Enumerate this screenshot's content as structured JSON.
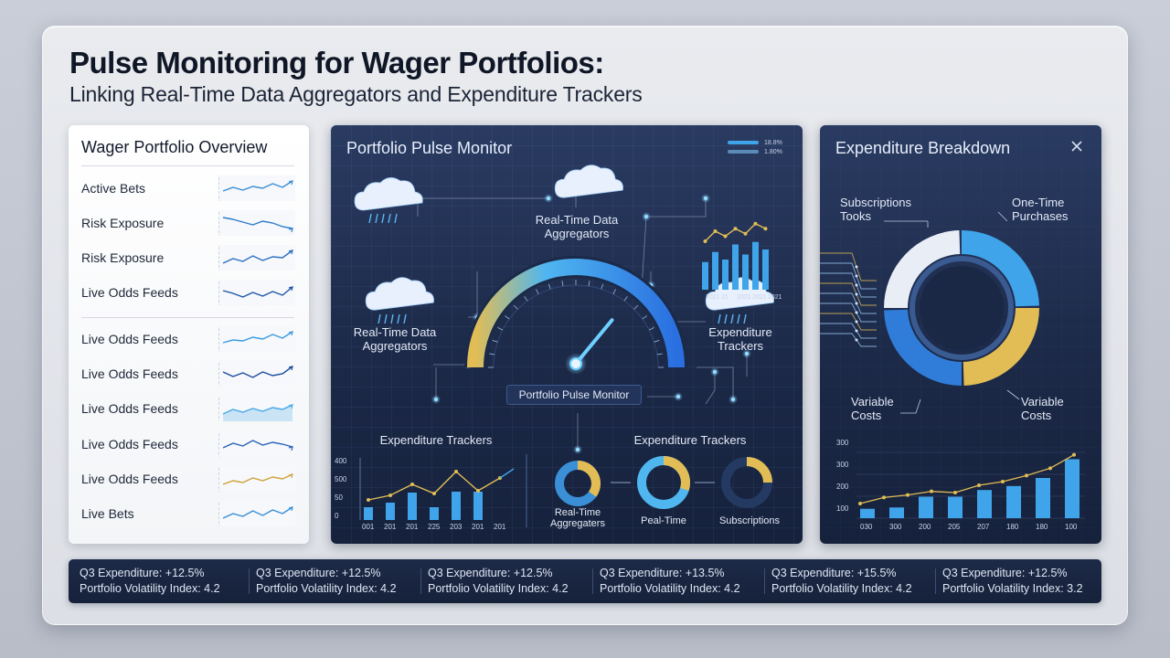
{
  "header": {
    "title": "Pulse Monitoring for Wager Portfolios:",
    "subtitle": "Linking Real-Time Data Aggregators and Expenditure Trackers"
  },
  "overview": {
    "title": "Wager Portfolio Overview",
    "rows": [
      {
        "label": "Active Bets",
        "trend": [
          0.35,
          0.55,
          0.4,
          0.6,
          0.5,
          0.75,
          0.55,
          0.9
        ],
        "color": "#3a8fd6",
        "fill": false
      },
      {
        "label": "Risk Exposure",
        "trend": [
          0.8,
          0.7,
          0.55,
          0.4,
          0.6,
          0.5,
          0.3,
          0.2
        ],
        "color": "#2f7ccc",
        "fill": false
      },
      {
        "label": "Risk Exposure",
        "trend": [
          0.2,
          0.45,
          0.3,
          0.6,
          0.35,
          0.55,
          0.5,
          0.9
        ],
        "color": "#2d6fc2",
        "fill": false
      },
      {
        "label": "Live Odds Feeds",
        "trend": [
          0.6,
          0.45,
          0.25,
          0.5,
          0.3,
          0.55,
          0.35,
          0.8
        ],
        "color": "#1f55a8",
        "fill": false
      },
      {
        "label": "Live Odds Feeds",
        "trend": [
          0.3,
          0.45,
          0.4,
          0.6,
          0.5,
          0.75,
          0.55,
          0.9
        ],
        "color": "#3a9be0",
        "fill": false
      },
      {
        "label": "Live Odds Feeds",
        "trend": [
          0.6,
          0.35,
          0.55,
          0.3,
          0.6,
          0.4,
          0.5,
          0.9
        ],
        "color": "#1c4ea0",
        "fill": false
      },
      {
        "label": "Live Odds Feeds",
        "trend": [
          0.2,
          0.45,
          0.3,
          0.5,
          0.35,
          0.55,
          0.45,
          0.7
        ],
        "color": "#47a9e6",
        "fill": true
      },
      {
        "label": "Live Odds Feeds",
        "trend": [
          0.3,
          0.55,
          0.4,
          0.7,
          0.45,
          0.6,
          0.5,
          0.35
        ],
        "color": "#2a62b8",
        "fill": false
      },
      {
        "label": "Live Odds Feeds",
        "trend": [
          0.2,
          0.4,
          0.3,
          0.55,
          0.4,
          0.6,
          0.5,
          0.75
        ],
        "color": "#d1a23d",
        "fill": false
      },
      {
        "label": "Live Bets",
        "trend": [
          0.25,
          0.5,
          0.35,
          0.65,
          0.4,
          0.7,
          0.5,
          0.85
        ],
        "color": "#3a8fd6",
        "fill": false
      }
    ]
  },
  "pulse": {
    "title": "Portfolio Pulse Monitor",
    "legend": [
      "18.8%",
      "1.80%"
    ],
    "node_top": "Real-Time Data\nAggregators",
    "node_left": "Real-Time Data\nAggregators",
    "node_right": "Expenditure\nTrackers",
    "gauge_label": "Portfolio Pulse Monitor",
    "gauge_value": 0.72,
    "mini_chart": {
      "type": "bar",
      "categories": [
        "2021",
        "21",
        "2021",
        "2021",
        "2021"
      ],
      "values": [
        0.55,
        0.75,
        0.6,
        0.9,
        0.7,
        0.95,
        0.8
      ],
      "line": [
        0.6,
        0.8,
        0.7,
        0.85,
        0.75,
        0.95,
        0.85
      ]
    },
    "bottom_left_title": "Expenditure Trackers",
    "bottom_right_title": "Expenditure Trackers",
    "bottom_chart": {
      "type": "bar",
      "yticks": [
        "400",
        "500",
        "50",
        "0"
      ],
      "categories": [
        "001",
        "201",
        "201",
        "225",
        "203",
        "201",
        "201"
      ],
      "values": [
        70,
        95,
        150,
        70,
        155,
        155,
        0
      ],
      "line": [
        110,
        135,
        195,
        145,
        265,
        160,
        230
      ]
    },
    "donuts": [
      {
        "label": "Real-Time\nAggregaters",
        "value": 0.35
      },
      {
        "label": "Peal-Time",
        "value": 0.3
      },
      {
        "label": "Subscriptions",
        "value": 0.25
      }
    ]
  },
  "expenditure": {
    "title": "Expenditure Breakdown",
    "segments": [
      {
        "label": "Subscriptions\nTooks",
        "value": 25,
        "color": "#e9eef6"
      },
      {
        "label": "One-Time\nPurchases",
        "value": 25,
        "color": "#3fa4ea"
      },
      {
        "label": "Variable\nCosts",
        "value": 25,
        "color": "#e2bd55"
      },
      {
        "label": "Variable\nCosts",
        "value": 25,
        "color": "#2f7dd8"
      }
    ],
    "chart": {
      "type": "bar",
      "yticks": [
        "300",
        "300",
        "200",
        "100"
      ],
      "categories": [
        "030",
        "300",
        "200",
        "205",
        "207",
        "180",
        "180",
        "100"
      ],
      "values": [
        35,
        40,
        80,
        80,
        105,
        120,
        150,
        220
      ],
      "line": [
        60,
        85,
        95,
        110,
        105,
        135,
        150,
        175,
        205,
        260
      ]
    }
  },
  "stats": [
    {
      "line1": "Q3 Expenditure: +12.5%",
      "line2": "Portfolio Volatility Index: 4.2"
    },
    {
      "line1": "Q3 Expenditure: +12.5%",
      "line2": "Portfolio Volatility Index: 4.2"
    },
    {
      "line1": "Q3 Expenditure: +12.5%",
      "line2": "Portfolio Volatility Index: 4.2"
    },
    {
      "line1": "Q3 Expenditure: +13.5%",
      "line2": "Portfolio Volatility Index: 4.2"
    },
    {
      "line1": "Q3 Expenditure: +15.5%",
      "line2": "Portfolio Volatility Index: 4.2"
    },
    {
      "line1": "Q3 Expenditure: +12.5%",
      "line2": "Portfolio Volatility Index: 3.2"
    }
  ],
  "colors": {
    "accent": "#3fa4ea",
    "gold": "#e2bd55",
    "dark": "#1b2846"
  }
}
